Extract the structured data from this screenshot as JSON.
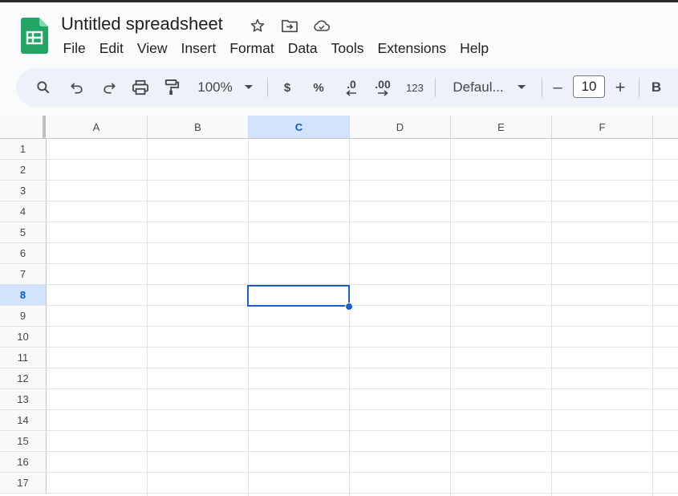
{
  "app": {
    "title": "Untitled spreadsheet",
    "logo_icon": "sheets-logo-icon",
    "brand_color": "#1e8e3e",
    "accent_color": "#0b57d0"
  },
  "title_icons": [
    "star-icon",
    "move-to-folder-icon",
    "cloud-saved-icon"
  ],
  "menu": [
    "File",
    "Edit",
    "View",
    "Insert",
    "Format",
    "Data",
    "Tools",
    "Extensions",
    "Help"
  ],
  "toolbar": {
    "zoom": "100%",
    "currency": "$",
    "percent": "%",
    "decrease_decimal": ".0",
    "increase_decimal": ".00",
    "number_format": "123",
    "font": "Defaul...",
    "font_size": "10",
    "bold": "B",
    "minus": "–",
    "plus": "+"
  },
  "grid": {
    "columns": [
      "A",
      "B",
      "C",
      "D",
      "E",
      "F"
    ],
    "rows": [
      "1",
      "2",
      "3",
      "4",
      "5",
      "6",
      "7",
      "8",
      "9",
      "10",
      "11",
      "12",
      "13",
      "14",
      "15",
      "16",
      "17"
    ],
    "selected_cell": "C8",
    "selected_column": "C",
    "selected_row": "8"
  }
}
